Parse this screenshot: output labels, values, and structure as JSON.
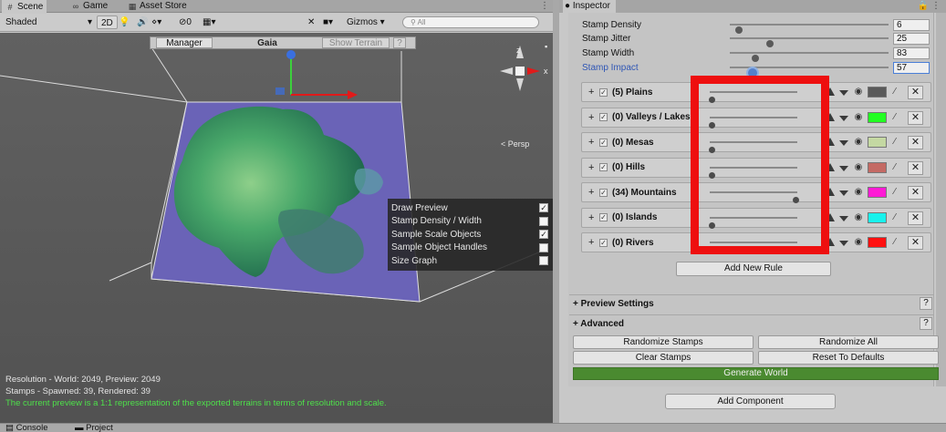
{
  "scene_tabs": [
    {
      "label": "Scene",
      "icon": "grid-icon"
    },
    {
      "label": "Game",
      "icon": "gamepad-icon"
    },
    {
      "label": "Asset Store",
      "icon": "store-icon"
    }
  ],
  "toolbar": {
    "shading_mode": "Shaded",
    "mode_2d": "2D",
    "effects_count": "0",
    "gizmos_label": "Gizmos",
    "search_placeholder": "All"
  },
  "gaia_bar": {
    "manager_label": "Manager",
    "title": "Gaia",
    "show_terrain_label": "Show Terrain",
    "help_label": "?"
  },
  "viewport": {
    "persp_label": "< Persp",
    "gizmo_axes": {
      "x": "x",
      "y": "y",
      "z": "z"
    }
  },
  "preview_menu": [
    {
      "label": "Draw Preview",
      "checked": true
    },
    {
      "label": "Stamp Density / Width",
      "checked": false
    },
    {
      "label": "Sample Scale Objects",
      "checked": true
    },
    {
      "label": "Sample Object Handles",
      "checked": false
    },
    {
      "label": "Size Graph",
      "checked": false
    }
  ],
  "scene_status": {
    "line1": "Resolution - World: 2049, Preview: 2049",
    "line2": "Stamps - Spawned: 39, Rendered: 39",
    "line3": "The current preview is a 1:1 representation of the exported terrains in terms of resolution and scale."
  },
  "bottom_tabs": [
    {
      "label": "Console",
      "icon": "console-icon"
    },
    {
      "label": "Project",
      "icon": "folder-icon"
    }
  ],
  "inspector": {
    "tab_label": "Inspector",
    "properties": [
      {
        "label": "Stamp Density",
        "value": "6",
        "fill": 0.06
      },
      {
        "label": "Stamp Jitter",
        "value": "25",
        "fill": 0.25
      },
      {
        "label": "Stamp Width",
        "value": "83",
        "fill": 0.16
      },
      {
        "label": "Stamp Impact",
        "value": "57",
        "fill": 0.14,
        "highlighted": true
      }
    ],
    "rules": [
      {
        "name": "(5) Plains",
        "enabled": true,
        "slider": 0.02,
        "color": "#5a5a5a"
      },
      {
        "name": "(0) Valleys / Lakes",
        "enabled": true,
        "slider": 0.02,
        "color": "#22ff22"
      },
      {
        "name": "(0) Mesas",
        "enabled": true,
        "slider": 0.02,
        "color": "#c4d8a2"
      },
      {
        "name": "(0) Hills",
        "enabled": true,
        "slider": 0.02,
        "color": "#c46a64"
      },
      {
        "name": "(34) Mountains",
        "enabled": true,
        "slider": 0.98,
        "color": "#ff1ad5"
      },
      {
        "name": "(0) Islands",
        "enabled": true,
        "slider": 0.02,
        "color": "#18f2ec"
      },
      {
        "name": "(0) Rivers",
        "enabled": true,
        "slider": 0.02,
        "color": "#ff1010"
      }
    ],
    "add_rule_label": "Add New Rule",
    "foldouts": [
      {
        "label": "+ Preview Settings",
        "help": "?"
      },
      {
        "label": "+ Advanced",
        "help": "?"
      }
    ],
    "buttons": {
      "randomize_stamps": "Randomize Stamps",
      "randomize_all": "Randomize All",
      "clear_stamps": "Clear Stamps",
      "reset_defaults": "Reset To Defaults",
      "generate_world": "Generate World",
      "add_component": "Add Component"
    }
  },
  "colors": {
    "highlight_box": "#ee0f0f",
    "generate_world": "#4a8a30",
    "accent_blue": "#2f56b5"
  }
}
